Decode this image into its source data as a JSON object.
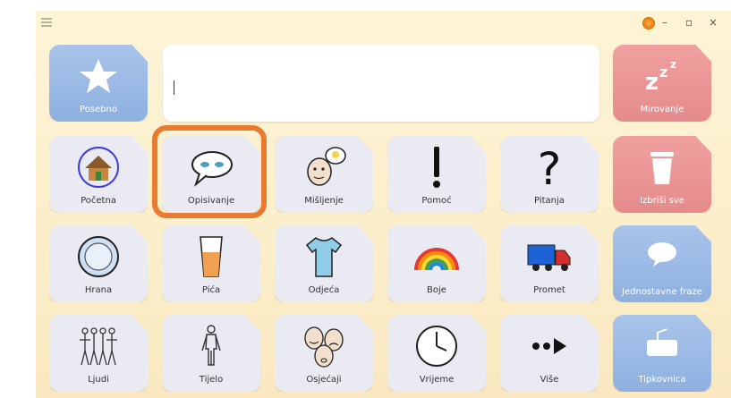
{
  "titlebar": {
    "minimize": "–",
    "restore": "▫",
    "close": "×"
  },
  "top_row": {
    "special": {
      "label": "Posebno",
      "icon": "star-icon"
    },
    "message": {
      "text": ""
    },
    "sleep": {
      "label": "Mirovanje",
      "icon": "zzz-icon"
    }
  },
  "grid": [
    [
      {
        "label": "Početna",
        "icon": "house-icon"
      },
      {
        "label": "Opisivanje",
        "icon": "speech-bubble-eyes-icon"
      },
      {
        "label": "Mišljenje",
        "icon": "thinking-face-icon"
      },
      {
        "label": "Pomoć",
        "icon": "exclamation-icon"
      },
      {
        "label": "Pitanja",
        "icon": "question-icon"
      },
      {
        "label": "Izbriši sve",
        "icon": "trash-icon"
      }
    ],
    [
      {
        "label": "Hrana",
        "icon": "plate-icon"
      },
      {
        "label": "Pića",
        "icon": "glass-icon"
      },
      {
        "label": "Odjeća",
        "icon": "tshirt-icon"
      },
      {
        "label": "Boje",
        "icon": "rainbow-icon"
      },
      {
        "label": "Promet",
        "icon": "truck-icon"
      },
      {
        "label": "Jednostavne fraze",
        "icon": "speech-bubble-icon"
      }
    ],
    [
      {
        "label": "Ljudi",
        "icon": "people-icon"
      },
      {
        "label": "Tijelo",
        "icon": "body-icon"
      },
      {
        "label": "Osjećaji",
        "icon": "faces-icon"
      },
      {
        "label": "Vrijeme",
        "icon": "clock-icon"
      },
      {
        "label": "Više",
        "icon": "more-arrow-icon"
      },
      {
        "label": "Tipkovnica",
        "icon": "keyboard-icon"
      }
    ]
  ],
  "colors": {
    "tile": "#e9eaf2",
    "accent_blue": "#8eb0e0",
    "accent_red": "#e58b8b",
    "highlight": "#e97b31",
    "background": "#fbeec9"
  }
}
